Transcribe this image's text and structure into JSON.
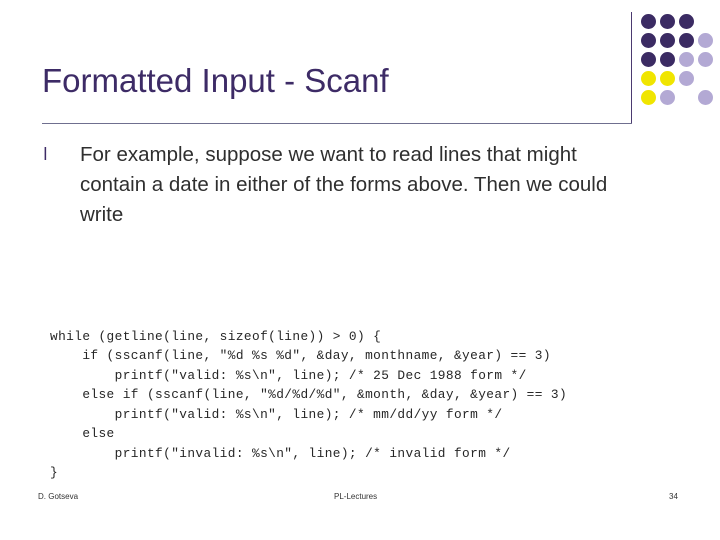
{
  "slide": {
    "title": "Formatted Input - Scanf",
    "bullet": {
      "marker": "l",
      "text": "For example, suppose we want to read lines that might contain a date in either of the forms above. Then we could write"
    },
    "code": "while (getline(line, sizeof(line)) > 0) {\n    if (sscanf(line, \"%d %s %d\", &day, monthname, &year) == 3)\n        printf(\"valid: %s\\n\", line); /* 25 Dec 1988 form */\n    else if (sscanf(line, \"%d/%d/%d\", &month, &day, &year) == 3)\n        printf(\"valid: %s\\n\", line); /* mm/dd/yy form */\n    else\n        printf(\"invalid: %s\\n\", line); /* invalid form */\n}",
    "footer": {
      "left": "D. Gotseva",
      "center": "PL-Lectures",
      "right": "34"
    },
    "colors": {
      "title": "#3d2b66",
      "rule": "#6f6f8f",
      "dot_dark_purple": "#3b2b63",
      "dot_medium_purple": "#7a6aa8",
      "dot_light_purple": "#b3a9d4",
      "dot_yellow": "#f0e500",
      "code_text": "#262626"
    },
    "dot_grid": {
      "rows": 5,
      "cols": 4,
      "matrix": [
        [
          "dark",
          "dark",
          "dark",
          "none"
        ],
        [
          "dark",
          "dark",
          "dark",
          "light"
        ],
        [
          "dark",
          "dark",
          "light",
          "light"
        ],
        [
          "yellow",
          "yellow",
          "light",
          "none"
        ],
        [
          "yellow",
          "light",
          "none",
          "light"
        ]
      ]
    }
  }
}
